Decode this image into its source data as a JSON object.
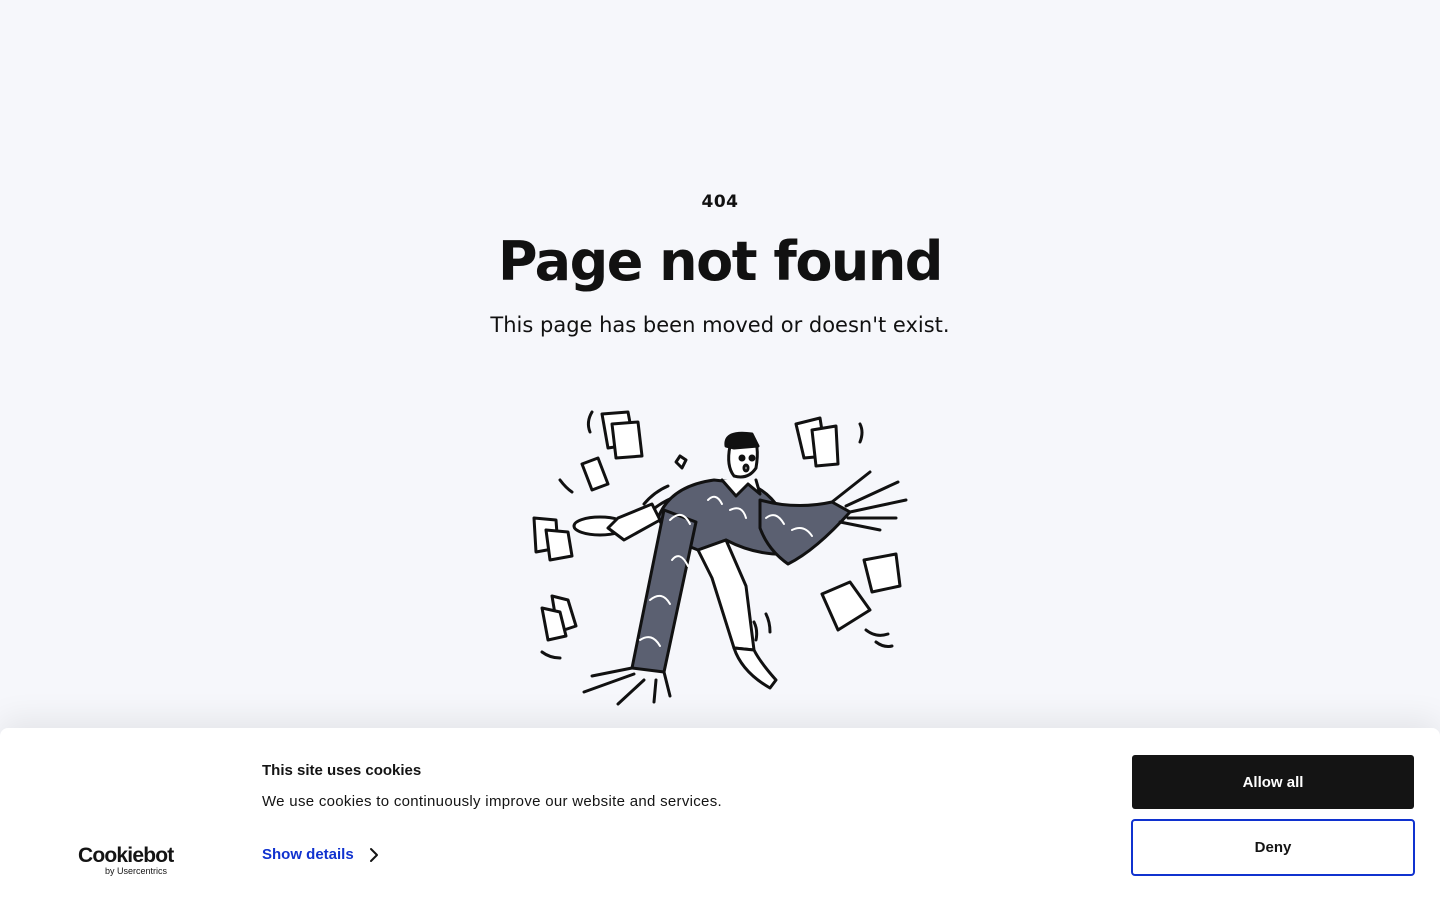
{
  "error": {
    "code": "404",
    "title": "Page not found",
    "subtitle": "This page has been moved or doesn't exist."
  },
  "illustration": {
    "icon": "confused-man-juggling-papers-illustration"
  },
  "cookie_banner": {
    "logo_main": "Cookiebot",
    "logo_sub": "by Usercentrics",
    "title": "This site uses cookies",
    "text": "We use cookies to continuously improve our website and services.",
    "show_details": "Show details",
    "allow_all": "Allow all",
    "deny": "Deny",
    "accent_color": "#1032cf",
    "primary_color": "#141414"
  }
}
